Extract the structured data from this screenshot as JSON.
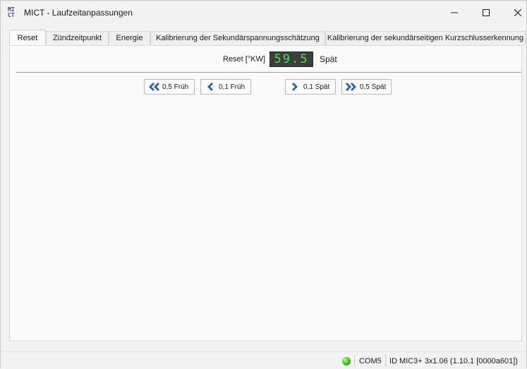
{
  "window": {
    "title": "MICT - Laufzeitanpassungen",
    "icon_text_top": "MI",
    "icon_text_bottom": "CT",
    "controls": [
      "minimize-icon",
      "maximize-icon",
      "close-icon"
    ]
  },
  "tabs": [
    {
      "label": "Reset",
      "active": true
    },
    {
      "label": "Zündzeitpunkt",
      "active": false
    },
    {
      "label": "Energie",
      "active": false
    },
    {
      "label": "Kalibrierung der Sekundärspannungsschätzung",
      "active": false
    },
    {
      "label": "Kalibrierung der sekundärseitigen Kurzschlusserkennung",
      "active": false
    }
  ],
  "reset": {
    "label": "Reset [°KW]",
    "display_value": "59.5",
    "direction": "Spät"
  },
  "buttons": {
    "early_05": {
      "label": "0,5 Früh",
      "icon": "double-chevron-left-icon"
    },
    "early_01": {
      "label": "0,1 Früh",
      "icon": "chevron-left-icon"
    },
    "late_01": {
      "label": "0,1 Spät",
      "icon": "chevron-right-icon"
    },
    "late_05": {
      "label": "0,5 Spät",
      "icon": "double-chevron-right-icon"
    }
  },
  "status": {
    "connection_color": "#3ccf1e",
    "port": "COM5",
    "device_id": "ID MIC3+ 3x1.06 (1.10.1 [0000a601])"
  },
  "colors": {
    "display_bg": "#3a3f3a",
    "display_digits": "#47e04f",
    "icon_blue": "#2a4a8a"
  }
}
